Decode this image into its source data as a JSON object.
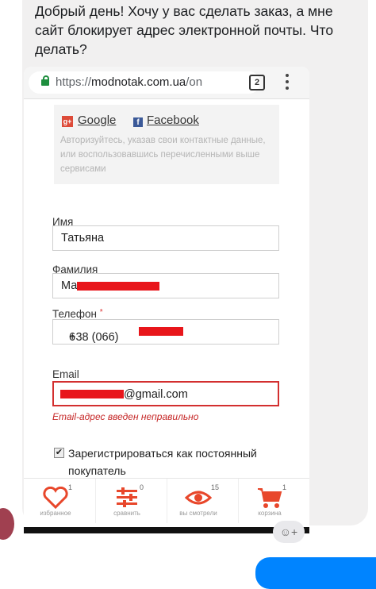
{
  "message": {
    "text": "Добрый день! Хочу у вас сделать заказ, а мне сайт блокирует адрес электронной почты. Что делать?"
  },
  "browser": {
    "url_scheme": "https://",
    "url_domain": "modnotak.com.ua",
    "url_path": "/on",
    "tab_count": "2"
  },
  "social": {
    "google_badge": "g+",
    "google_label": "Google",
    "facebook_badge": "f",
    "facebook_label": "Facebook",
    "hint": "Авторизуйтесь, указав свои контактные данные, или воспользовавшись перечисленными выше сервисами"
  },
  "form": {
    "name_label": "Имя",
    "name_value": "Татьяна",
    "surname_label": "Фамилия",
    "surname_value": "Ма",
    "phone_label": "Телефон",
    "phone_required": "*",
    "phone_prefix": "+38 (066)",
    "phone_suffix": "6",
    "email_label": "Email",
    "email_value": "@gmail.com",
    "email_error": "Email-адрес введен неправильно",
    "register_checked": "✔",
    "register_label": "Зарегистрироваться как постоянный покупатель"
  },
  "bottom_nav": [
    {
      "icon": "heart-icon",
      "count": "1",
      "label": "избранное"
    },
    {
      "icon": "filters-icon",
      "count": "0",
      "label": "сравнить"
    },
    {
      "icon": "eye-icon",
      "count": "15",
      "label": "вы смотрели"
    },
    {
      "icon": "cart-icon",
      "count": "1",
      "label": "корзина"
    }
  ],
  "colors": {
    "accent": "#e8472b",
    "error": "#d32f2f",
    "secure": "#1e8e3e"
  }
}
